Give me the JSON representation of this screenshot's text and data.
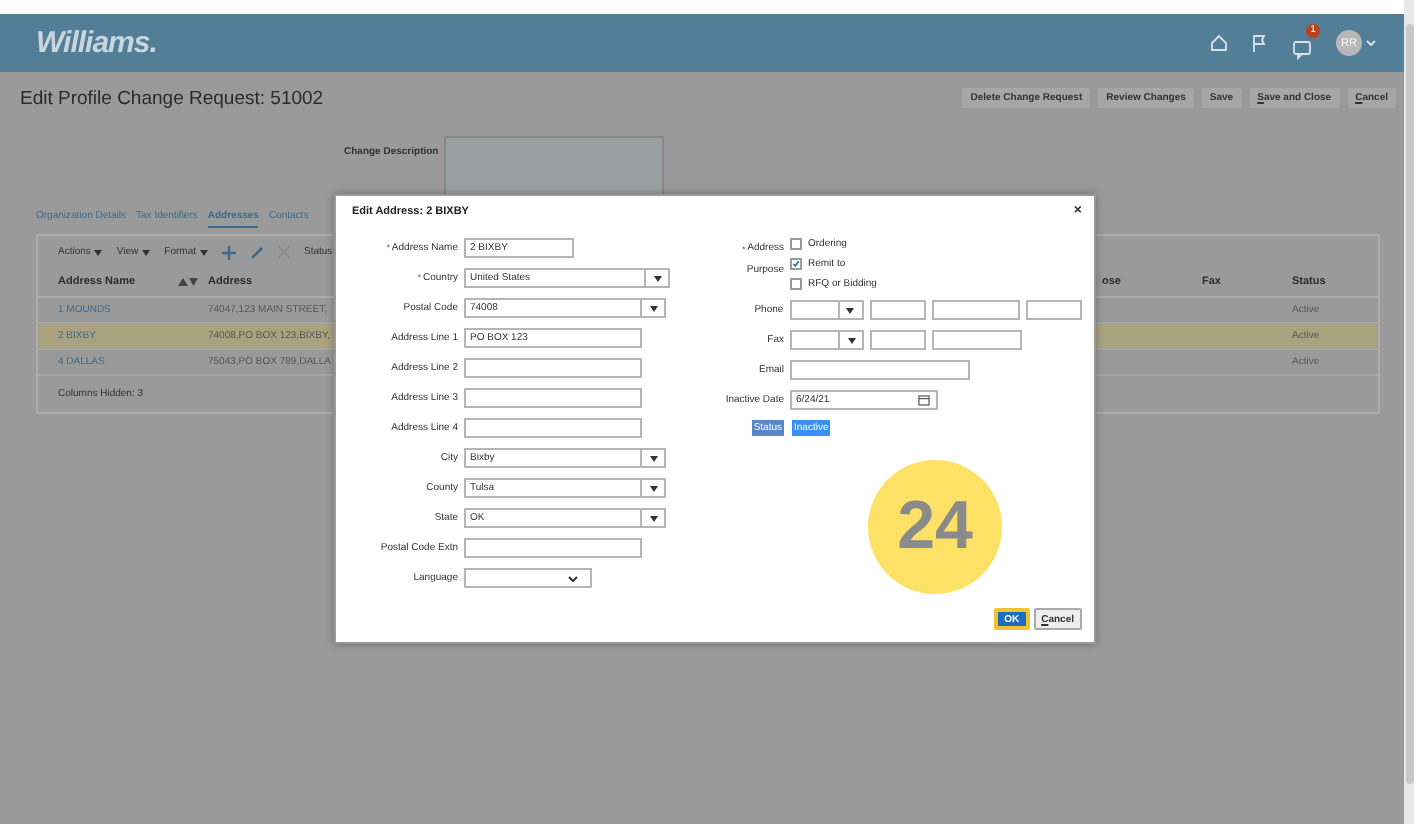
{
  "header": {
    "logo": "Williams.",
    "notification_count": "1",
    "avatar": "RR"
  },
  "page": {
    "title": "Edit Profile Change Request: 51002",
    "buttons": [
      {
        "label": "Delete Change Request",
        "mnemonic": false
      },
      {
        "label": "Review Changes",
        "mnemonic": false
      },
      {
        "label": "Save",
        "mnemonic": false
      },
      {
        "label": "Save and Close",
        "mnemonic": true
      },
      {
        "label": "Cancel",
        "mnemonic": true
      }
    ]
  },
  "change_description": {
    "label": "Change Description"
  },
  "tabs": [
    {
      "label": "Organization Details",
      "selected": false
    },
    {
      "label": "Tax Identifiers",
      "selected": false
    },
    {
      "label": "Addresses",
      "selected": true
    },
    {
      "label": "Contacts",
      "selected": false
    }
  ],
  "table": {
    "menus": [
      "Actions",
      "View",
      "Format"
    ],
    "status_label": "Status",
    "columns": [
      "Address Name",
      "Address",
      "ose",
      "Fax",
      "Status"
    ],
    "rows": [
      {
        "name": "1 MOUNDS",
        "address": "74047,123 MAIN STREET,",
        "status": "Active",
        "selected": false
      },
      {
        "name": "2 BIXBY",
        "address": "74008,PO BOX 123,BIXBY,",
        "status": "Active",
        "selected": true
      },
      {
        "name": "4 DALLAS",
        "address": "75043,PO BOX 789,DALLA",
        "status": "Active",
        "selected": false
      }
    ],
    "footer": "Columns Hidden: 3"
  },
  "dialog": {
    "title": "Edit Address: 2 BIXBY",
    "close": "×",
    "required_mark": "*",
    "left_fields": [
      {
        "label": "Address Name",
        "required": true,
        "kind": "text",
        "value": "2 BIXBY"
      },
      {
        "label": "Country",
        "required": true,
        "kind": "combo",
        "value": "United States"
      },
      {
        "label": "Postal Code",
        "required": false,
        "kind": "combo",
        "value": "74008"
      },
      {
        "label": "Address Line 1",
        "required": false,
        "kind": "text",
        "value": "PO BOX 123"
      },
      {
        "label": "Address Line 2",
        "required": false,
        "kind": "text"
      },
      {
        "label": "Address Line 3",
        "required": false,
        "kind": "text"
      },
      {
        "label": "Address Line 4",
        "required": false,
        "kind": "text"
      },
      {
        "label": "City",
        "required": false,
        "kind": "combo",
        "value": "Bixby"
      },
      {
        "label": "County",
        "required": false,
        "kind": "combo",
        "value": "Tulsa"
      },
      {
        "label": "State",
        "required": false,
        "kind": "combo",
        "value": "OK"
      },
      {
        "label": "Postal Code Extn",
        "required": false,
        "kind": "text"
      },
      {
        "label": "Language",
        "required": false,
        "kind": "select"
      }
    ],
    "purpose": {
      "label": "Address",
      "label_2": "Purpose",
      "required": true,
      "options": [
        {
          "label": "Ordering",
          "checked": false
        },
        {
          "label": "Remit to",
          "checked": true
        },
        {
          "label": "RFQ or Bidding",
          "checked": false
        }
      ]
    },
    "right_fields": [
      {
        "label": "Phone",
        "kind": "phone"
      },
      {
        "label": "Fax",
        "kind": "fax"
      },
      {
        "label": "Email",
        "kind": "text"
      },
      {
        "label": "Inactive Date",
        "kind": "date",
        "value": "6/24/21"
      },
      {
        "label": "Status",
        "kind": "status",
        "value": "Inactive"
      }
    ],
    "buttons": [
      {
        "label": "OK",
        "primary": true,
        "mnemonic": false
      },
      {
        "label": "Cancel",
        "primary": false,
        "mnemonic": true
      }
    ]
  },
  "step_badge": "24"
}
